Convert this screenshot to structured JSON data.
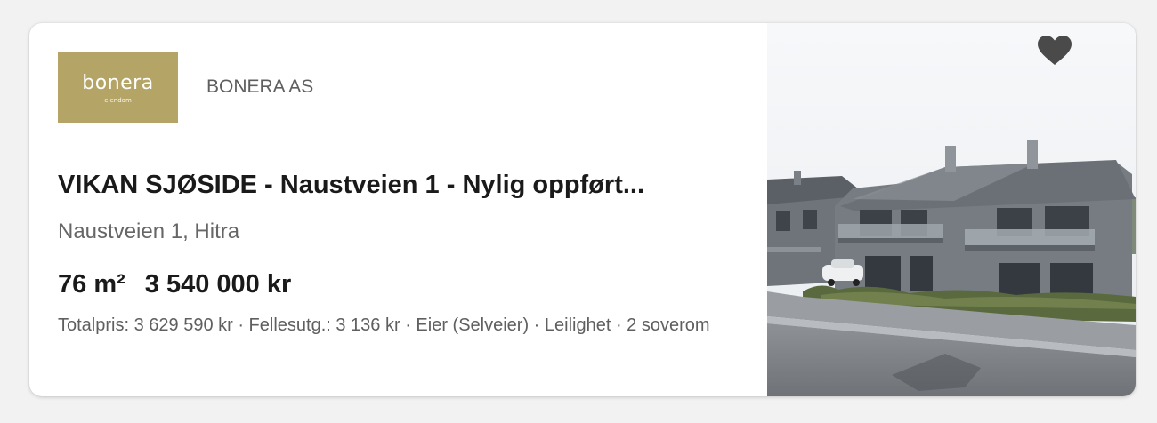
{
  "listing": {
    "logo": {
      "word": "bonera",
      "sub": "eiendom",
      "bg_color": "#b4a466"
    },
    "company": "BONERA AS",
    "title": "VIKAN SJØSIDE - Naustveien 1 - Nylig oppført...",
    "address": "Naustveien 1, Hitra",
    "size": "76 m²",
    "price": "3 540 000 kr",
    "details": "Totalpris: 3 629 590 kr · Fellesutg.: 3 136 kr · Eier (Selveier) · Leilighet · 2 soverom",
    "favorite_icon": "heart-icon"
  }
}
